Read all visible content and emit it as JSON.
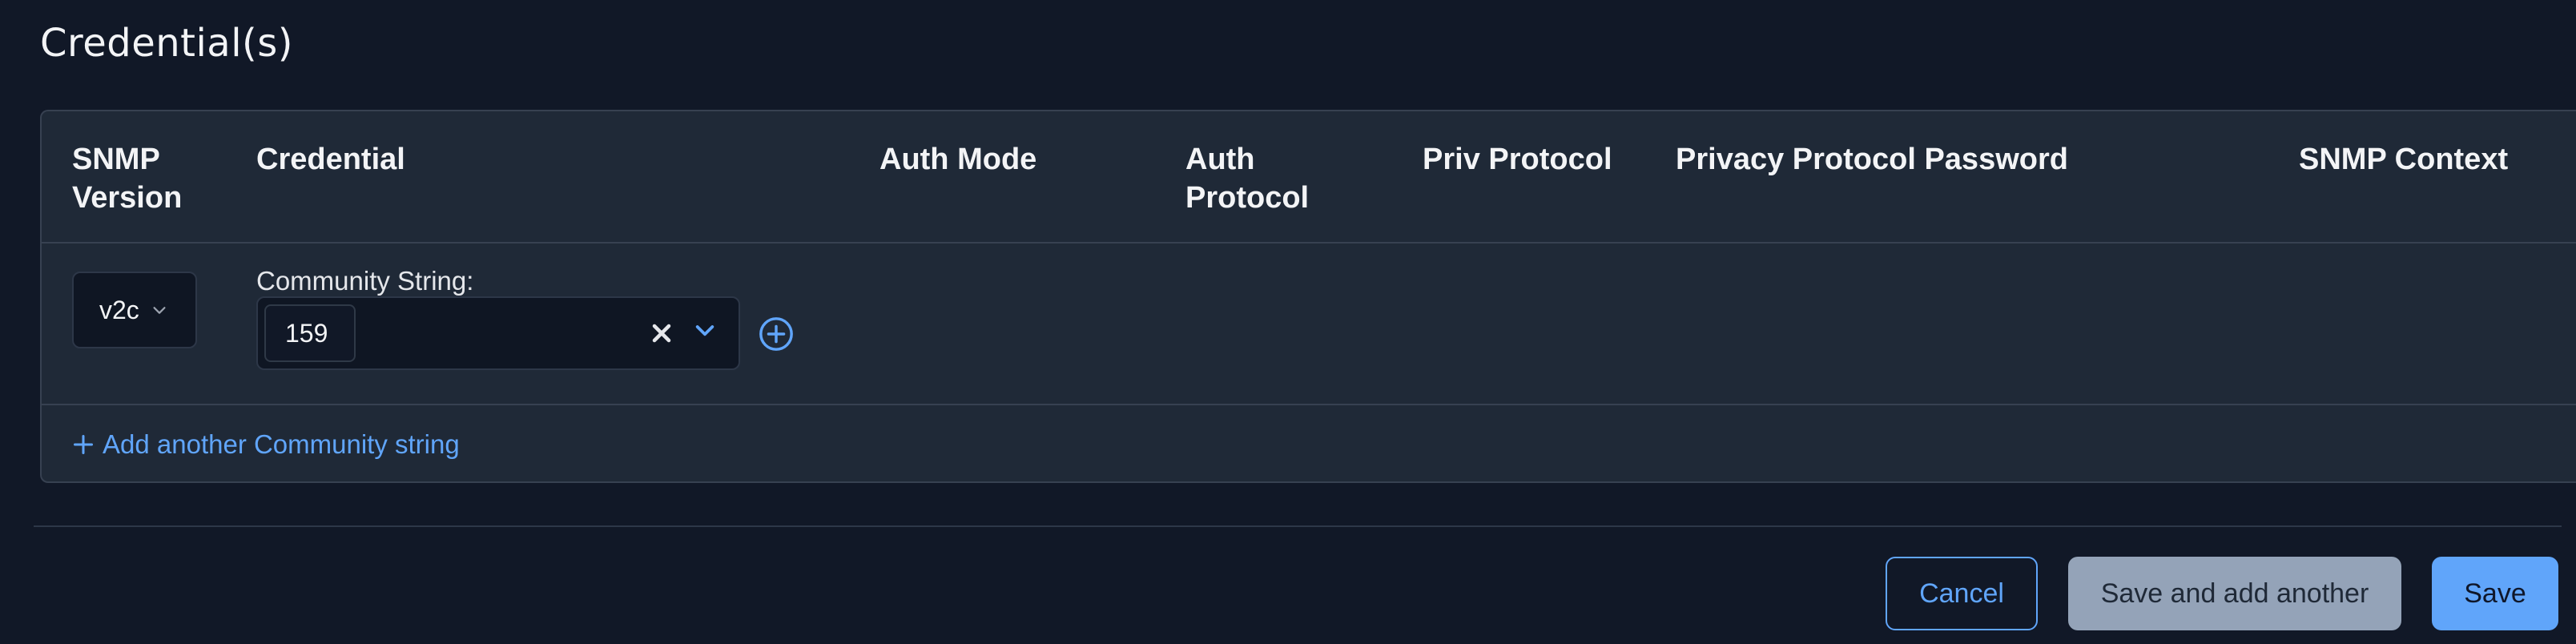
{
  "section": {
    "title": "Credential(s)"
  },
  "table": {
    "columns": [
      "SNMP\nVersion",
      "Credential",
      "Auth Mode",
      "Auth\nProtocol",
      "Priv Protocol",
      "Privacy Protocol Password",
      "SNMP Context"
    ],
    "row": {
      "snmp_version": "v2c",
      "credential_label": "Community String:",
      "credential_value": "159"
    },
    "add_link": "Add another Community string"
  },
  "actions": {
    "cancel": "Cancel",
    "save_and_add": "Save and add another",
    "save": "Save"
  },
  "colors": {
    "background": "#111827",
    "panel": "#1f2937",
    "accent": "#60a5fa",
    "secondary_button": "#94a3b8"
  },
  "icons": [
    "chevron-down-icon",
    "clear-icon",
    "dropdown-chevron-icon",
    "add-circle-icon",
    "plus-icon"
  ]
}
